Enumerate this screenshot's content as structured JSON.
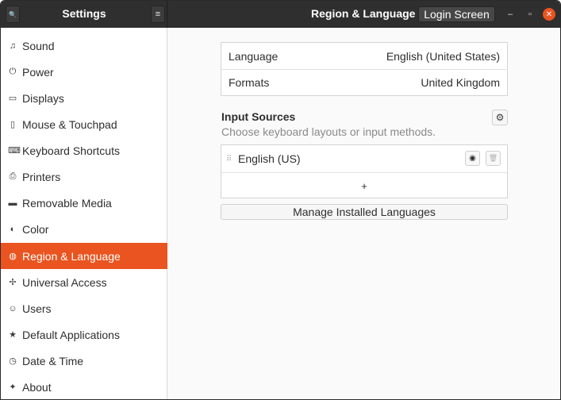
{
  "header": {
    "sidebar_title": "Settings",
    "panel_title": "Region & Language",
    "login_screen_label": "Login Screen",
    "search_icon": "🔍",
    "menu_icon": "≡",
    "minimize_icon": "–",
    "maximize_icon": "▫",
    "close_icon": "✕"
  },
  "sidebar": {
    "items": [
      {
        "label": "Sound",
        "icon": "♫",
        "icon_name": "speaker-icon"
      },
      {
        "label": "Power",
        "icon": "⏻",
        "icon_name": "power-icon"
      },
      {
        "label": "Displays",
        "icon": "▭",
        "icon_name": "display-icon"
      },
      {
        "label": "Mouse & Touchpad",
        "icon": "▯",
        "icon_name": "mouse-icon"
      },
      {
        "label": "Keyboard Shortcuts",
        "icon": "⌨",
        "icon_name": "keyboard-icon"
      },
      {
        "label": "Printers",
        "icon": "⎙",
        "icon_name": "printer-icon"
      },
      {
        "label": "Removable Media",
        "icon": "▬",
        "icon_name": "media-icon"
      },
      {
        "label": "Color",
        "icon": "◐",
        "icon_name": "color-icon"
      },
      {
        "label": "Region & Language",
        "icon": "◍",
        "icon_name": "globe-icon",
        "active": true
      },
      {
        "label": "Universal Access",
        "icon": "✢",
        "icon_name": "accessibility-icon"
      },
      {
        "label": "Users",
        "icon": "☺",
        "icon_name": "users-icon"
      },
      {
        "label": "Default Applications",
        "icon": "★",
        "icon_name": "star-icon"
      },
      {
        "label": "Date & Time",
        "icon": "◷",
        "icon_name": "clock-icon"
      },
      {
        "label": "About",
        "icon": "✦",
        "icon_name": "about-icon"
      }
    ],
    "accent_color": "#E95420"
  },
  "region": {
    "language_label": "Language",
    "language_value": "English (United States)",
    "formats_label": "Formats",
    "formats_value": "United Kingdom"
  },
  "input_sources": {
    "title": "Input Sources",
    "subtitle": "Choose keyboard layouts or input methods.",
    "gear_icon": "⚙",
    "sources": [
      {
        "name": "English (US)"
      }
    ],
    "drag_icon": "⠿",
    "eye_icon": "◉",
    "trash_icon": "🗑",
    "add_icon": "+",
    "manage_label": "Manage Installed Languages"
  }
}
